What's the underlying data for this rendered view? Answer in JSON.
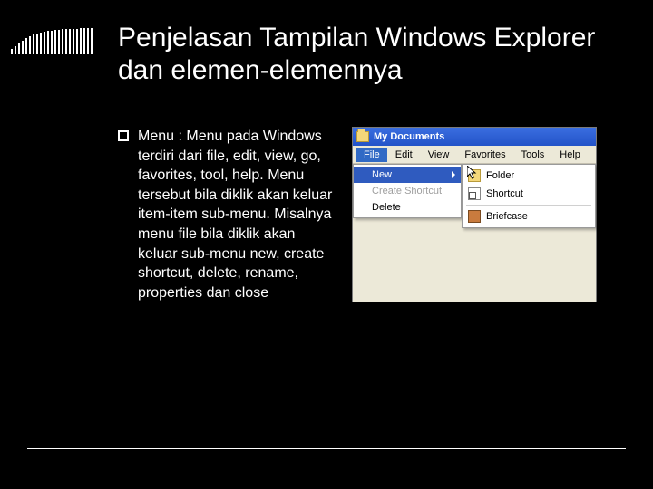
{
  "slide": {
    "title": "Penjelasan Tampilan Windows Explorer dan elemen-elemennya",
    "bullet": "Menu : Menu pada Windows terdiri dari file, edit, view, go, favorites, tool, help. Menu tersebut bila diklik akan keluar item-item sub-menu. Misalnya menu file bila diklik akan keluar sub-menu new, create shortcut, delete, rename, properties dan close"
  },
  "explorer": {
    "title": "My Documents",
    "menu": {
      "file": "File",
      "edit": "Edit",
      "view": "View",
      "favorites": "Favorites",
      "tools": "Tools",
      "help": "Help"
    },
    "fileMenu": {
      "new": "New",
      "createShortcut": "Create Shortcut",
      "delete": "Delete"
    },
    "newSubmenu": {
      "folder": "Folder",
      "shortcut": "Shortcut",
      "briefcase": "Briefcase"
    }
  }
}
